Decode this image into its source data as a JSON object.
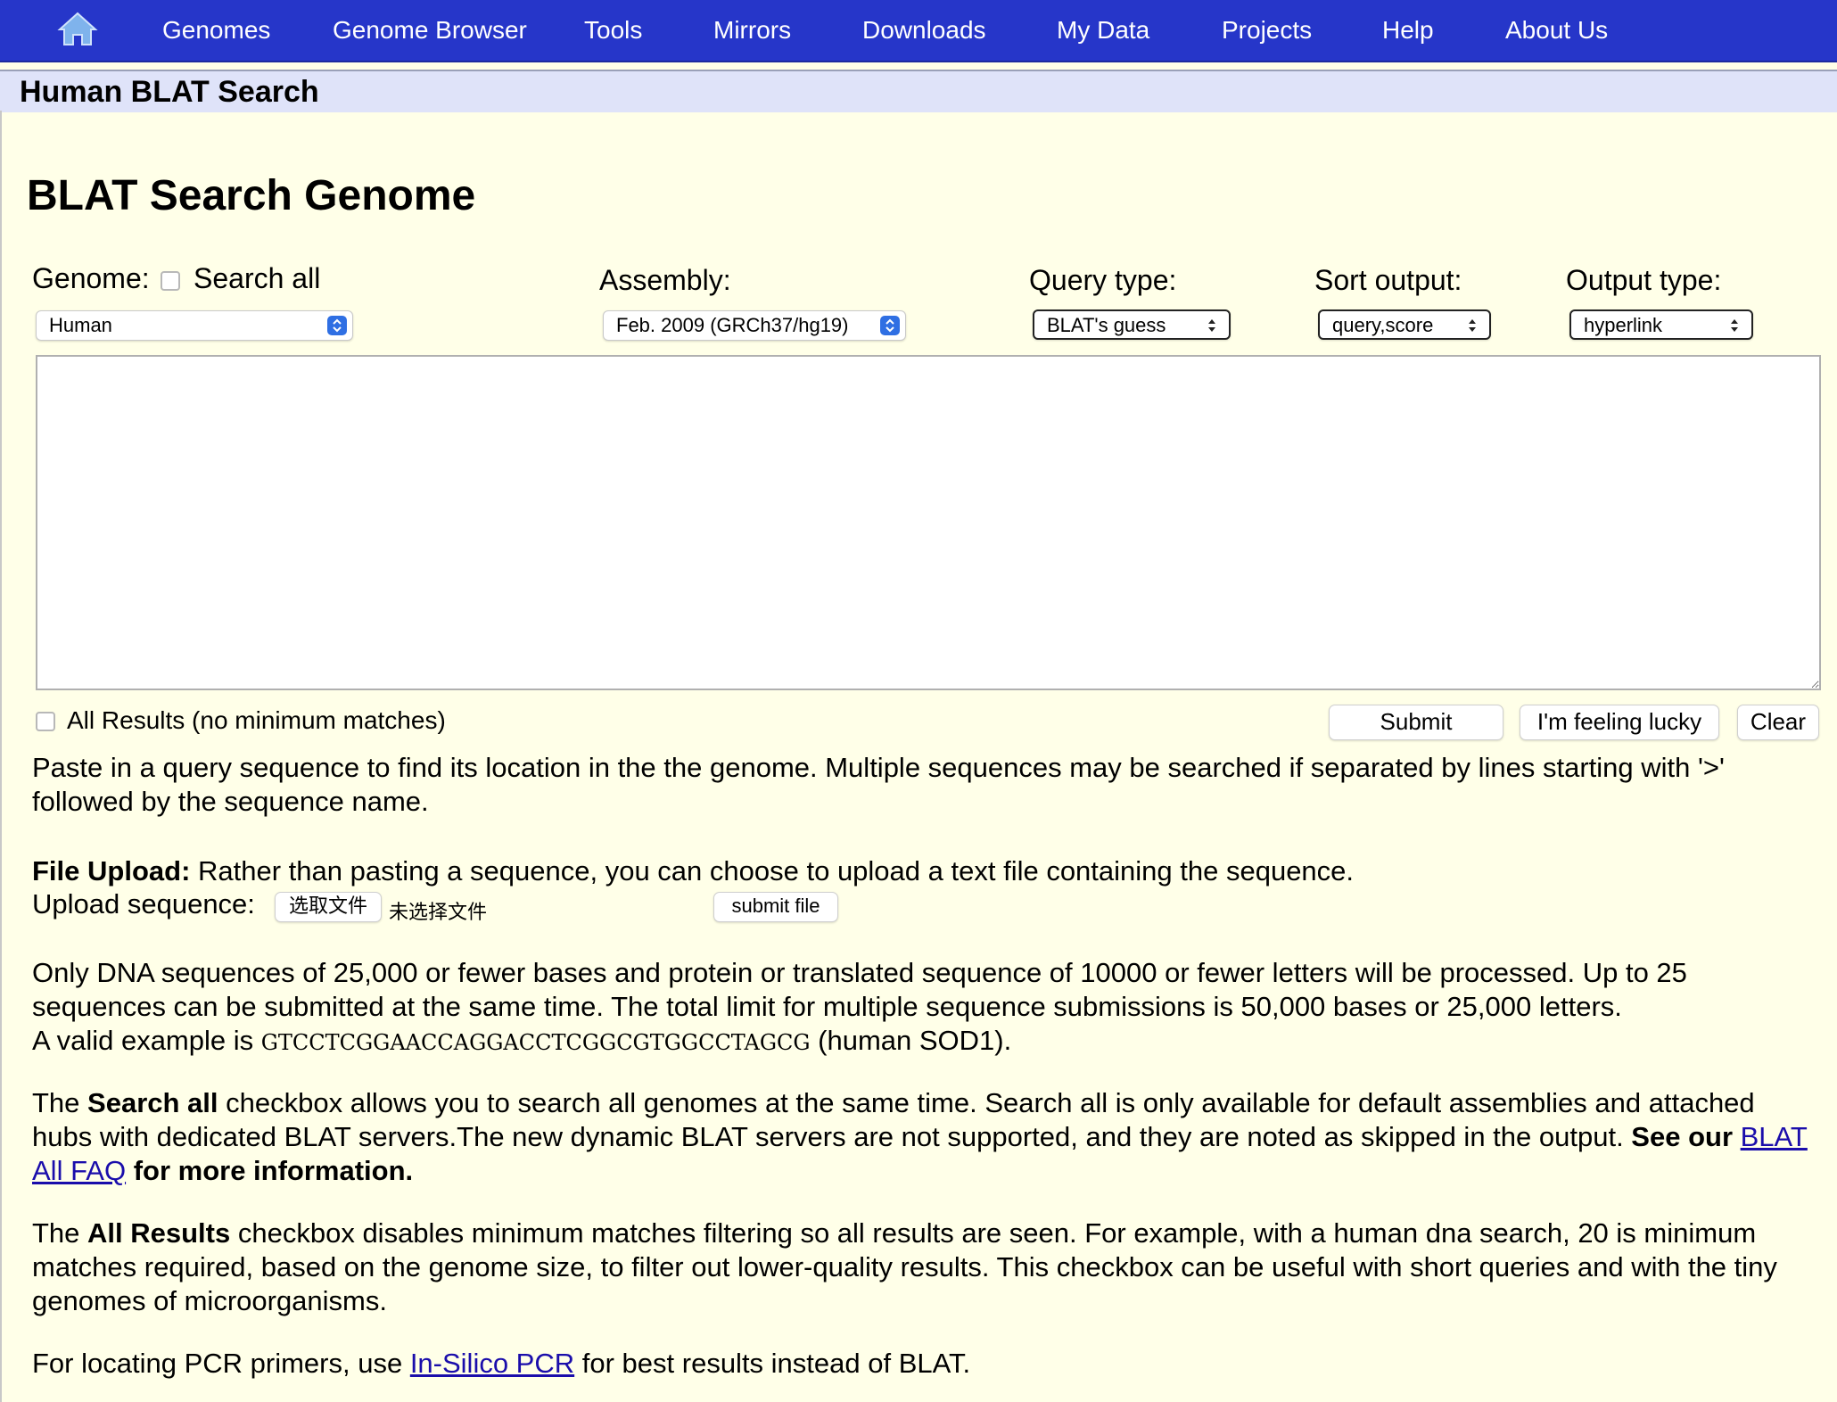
{
  "nav": {
    "home_icon": "home-icon",
    "items": [
      "Genomes",
      "Genome Browser",
      "Tools",
      "Mirrors",
      "Downloads",
      "My Data",
      "Projects",
      "Help",
      "About Us"
    ],
    "bg_color": "#2636c9"
  },
  "page_title": "Human BLAT Search",
  "heading": "BLAT Search Genome",
  "form": {
    "genome_label": "Genome:",
    "search_all_label": "Search all",
    "search_all_checked": false,
    "genome_value": "Human",
    "assembly_label": "Assembly:",
    "assembly_value": "Feb. 2009 (GRCh37/hg19)",
    "query_type_label": "Query type:",
    "query_type_value": "BLAT's guess",
    "sort_output_label": "Sort output:",
    "sort_output_value": "query,score",
    "output_type_label": "Output type:",
    "output_type_value": "hyperlink",
    "sequence_value": "",
    "all_results_label": "All Results (no minimum matches)",
    "all_results_checked": false,
    "submit_label": "Submit",
    "lucky_label": "I'm feeling lucky",
    "clear_label": "Clear"
  },
  "help": {
    "paste_text": "Paste in a query sequence to find its location in the the genome. Multiple sequences may be searched if separated by lines starting with '>' followed by the sequence name.",
    "file_upload_bold": "File Upload:",
    "file_upload_text": " Rather than pasting a sequence, you can choose to upload a text file containing the sequence.",
    "upload_label": "Upload sequence:",
    "choose_file_label": "选取文件",
    "no_file_text": "未选择文件",
    "submit_file_label": "submit file",
    "limits_text": "Only DNA sequences of 25,000 or fewer bases and protein or translated sequence of 10000 or fewer letters will be processed. Up to 25 sequences can be submitted at the same time. The total limit for multiple sequence submissions is 50,000 bases or 25,000 letters.",
    "example_prefix": "A valid example is ",
    "example_seq": "GTCCTCGGAACCAGGACCTCGGCGTGGCCTAGCG",
    "example_suffix": " (human SOD1).",
    "search_all_p1": "The ",
    "search_all_bold": "Search all",
    "search_all_p2": " checkbox allows you to search all genomes at the same time. Search all is only available for default assemblies and attached hubs with dedicated BLAT servers.The new dynamic BLAT servers are not supported, and they are noted as skipped in the output. ",
    "search_all_bold2": "See our ",
    "faq_link": "BLAT All FAQ",
    "search_all_bold3": " for more information.",
    "all_results_p1": "The ",
    "all_results_bold": "All Results",
    "all_results_p2": " checkbox disables minimum matches filtering so all results are seen. For example, with a human dna search, 20 is minimum matches required, based on the genome size, to filter out lower-quality results. This checkbox can be useful with short queries and with the tiny genomes of microorganisms.",
    "pcr_p1": "For locating PCR primers, use ",
    "pcr_link": "In-Silico PCR",
    "pcr_p2": " for best results instead of BLAT."
  }
}
